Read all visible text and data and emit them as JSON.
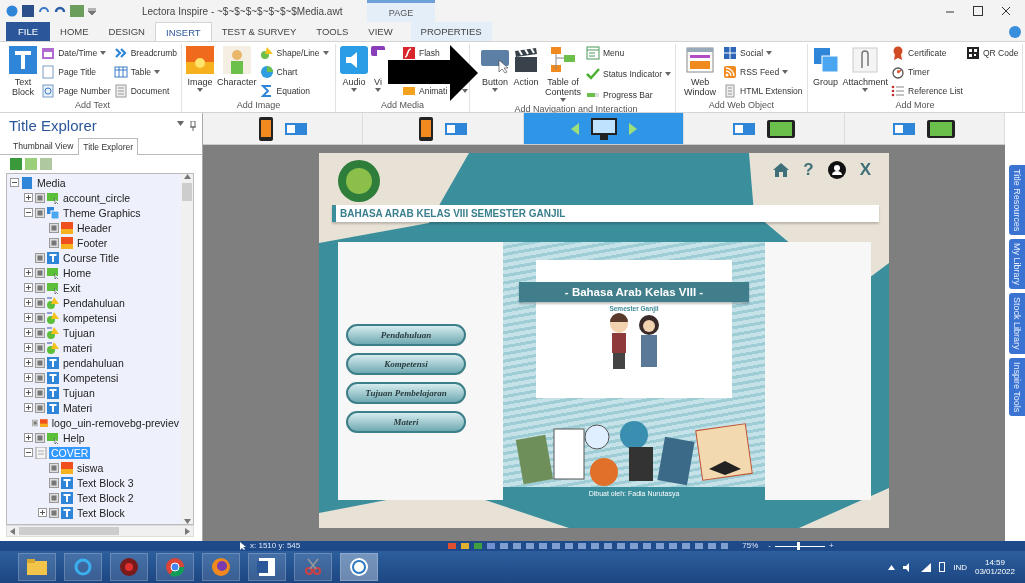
{
  "title_bar": {
    "title": "Lectora Inspire - ~$~$~$~$~$~$~$Media.awt",
    "context_group": "PAGE"
  },
  "ribbon_tabs": [
    {
      "label": "FILE",
      "kind": "file",
      "selected": false
    },
    {
      "label": "HOME",
      "kind": "tab",
      "selected": false
    },
    {
      "label": "DESIGN",
      "kind": "tab",
      "selected": false
    },
    {
      "label": "INSERT",
      "kind": "tab",
      "selected": true
    },
    {
      "label": "TEST & SURVEY",
      "kind": "tab",
      "selected": false
    },
    {
      "label": "TOOLS",
      "kind": "tab",
      "selected": false
    },
    {
      "label": "VIEW",
      "kind": "tab",
      "selected": false
    },
    {
      "label": "PROPERTIES",
      "kind": "context",
      "selected": false
    }
  ],
  "ribbon_groups": [
    {
      "label": "Add Text",
      "large": [
        {
          "label": "Text Block",
          "dropdown": false
        }
      ],
      "columns": [
        [
          {
            "label": "Date/Time",
            "dropdown": true
          },
          {
            "label": "Page Title",
            "dropdown": false
          },
          {
            "label": "Page Number",
            "dropdown": false
          }
        ],
        [
          {
            "label": "Breadcrumb",
            "dropdown": false
          },
          {
            "label": "Table",
            "dropdown": true
          },
          {
            "label": "Document",
            "dropdown": false
          }
        ]
      ]
    },
    {
      "label": "Add Image",
      "large": [
        {
          "label": "Image",
          "dropdown": true
        },
        {
          "label": "Character",
          "dropdown": false
        }
      ],
      "columns": [
        [
          {
            "label": "Shape/Line",
            "dropdown": true
          },
          {
            "label": "Chart",
            "dropdown": false
          },
          {
            "label": "Equation",
            "dropdown": false
          }
        ]
      ]
    },
    {
      "label": "Add Media",
      "large": [
        {
          "label": "Audio",
          "dropdown": true
        },
        {
          "label": "Vi",
          "dropdown": true
        }
      ],
      "columns": [
        [
          {
            "label": "Flash",
            "dropdown": false
          },
          {
            "label": "Animati",
            "dropdown": true
          }
        ]
      ]
    },
    {
      "label": "Add Navigation and Interaction",
      "large": [
        {
          "label": "Button",
          "dropdown": true
        },
        {
          "label": "Action",
          "dropdown": false
        },
        {
          "label": "Table of Contents",
          "dropdown": true
        }
      ],
      "columns": [
        [
          {
            "label": "Menu",
            "dropdown": false
          },
          {
            "label": "Status Indicator",
            "dropdown": true
          },
          {
            "label": "Progress Bar",
            "dropdown": false
          }
        ]
      ]
    },
    {
      "label": "Add Web Object",
      "large": [
        {
          "label": "Web Window",
          "dropdown": false
        }
      ],
      "columns": [
        [
          {
            "label": "Social",
            "dropdown": true
          },
          {
            "label": "RSS Feed",
            "dropdown": true
          },
          {
            "label": "HTML Extension",
            "dropdown": false
          }
        ]
      ]
    },
    {
      "label": "Add More",
      "large": [
        {
          "label": "Group",
          "dropdown": false
        },
        {
          "label": "Attachment",
          "dropdown": true
        }
      ],
      "columns": [
        [
          {
            "label": "Certificate",
            "dropdown": false
          },
          {
            "label": "Timer",
            "dropdown": false
          },
          {
            "label": "Reference List",
            "dropdown": false
          }
        ],
        [
          {
            "label": "QR Code",
            "dropdown": false
          }
        ]
      ]
    }
  ],
  "explorer": {
    "title": "Title Explorer",
    "tabs": [
      {
        "label": "Thumbnail View",
        "selected": false
      },
      {
        "label": "Title Explorer",
        "selected": true
      }
    ],
    "tree": [
      {
        "label": "Media",
        "kind": "book",
        "expanded": true,
        "selected": false,
        "children": [
          {
            "label": "account_circle",
            "kind": "button",
            "expanded": false,
            "selected": false
          },
          {
            "label": "Theme Graphics",
            "kind": "group",
            "expanded": true,
            "selected": false,
            "children": [
              {
                "label": "Header",
                "kind": "image",
                "selected": false
              },
              {
                "label": "Footer",
                "kind": "image",
                "selected": false
              }
            ]
          },
          {
            "label": "Course Title",
            "kind": "text",
            "selected": false
          },
          {
            "label": "Home",
            "kind": "button",
            "expanded": false,
            "selected": false
          },
          {
            "label": "Exit",
            "kind": "button",
            "expanded": false,
            "selected": false
          },
          {
            "label": "Pendahuluan",
            "kind": "shape",
            "expanded": false,
            "selected": false
          },
          {
            "label": "kompetensi",
            "kind": "shape",
            "expanded": false,
            "selected": false
          },
          {
            "label": "Tujuan",
            "kind": "shape",
            "expanded": false,
            "selected": false
          },
          {
            "label": "materi",
            "kind": "shape",
            "expanded": false,
            "selected": false
          },
          {
            "label": "pendahuluan",
            "kind": "text",
            "expanded": false,
            "selected": false
          },
          {
            "label": "Kompetensi",
            "kind": "text",
            "expanded": false,
            "selected": false
          },
          {
            "label": "Tujuan",
            "kind": "text",
            "expanded": false,
            "selected": false
          },
          {
            "label": "Materi",
            "kind": "text",
            "expanded": false,
            "selected": false
          },
          {
            "label": "logo_uin-removebg-previev",
            "kind": "image",
            "selected": false
          },
          {
            "label": "Help",
            "kind": "button",
            "expanded": false,
            "selected": false
          },
          {
            "label": "COVER",
            "kind": "page",
            "expanded": true,
            "selected": true,
            "children": [
              {
                "label": "siswa",
                "kind": "image",
                "selected": false
              },
              {
                "label": "Text Block 3",
                "kind": "text",
                "selected": false
              },
              {
                "label": "Text Block 2",
                "kind": "text",
                "selected": false
              },
              {
                "label": "Text Block",
                "kind": "text",
                "expanded": false,
                "selected": false
              }
            ]
          }
        ]
      }
    ]
  },
  "devices": [
    {
      "kind": "phone",
      "selected": false
    },
    {
      "kind": "phone",
      "selected": false
    },
    {
      "kind": "desktop",
      "selected": true
    },
    {
      "kind": "tablet",
      "selected": false
    },
    {
      "kind": "tablet",
      "selected": false
    }
  ],
  "preview": {
    "help_label": "?",
    "close_label": "X",
    "heading": "BAHASA ARAB KELAS VIII SEMESTER GANJIL",
    "menu": [
      "Pendahuluan",
      "Kompetensi",
      "Tujuan Pembelajaran",
      "Materi"
    ],
    "cover_title": "- Bahasa Arab Kelas VIII -",
    "cover_subtitle": "Semester Ganjil",
    "credit": "Dibuat oleh: Fadia Nurutasya"
  },
  "side_tabs": [
    "Title Resources",
    "My Library",
    "Stock Library",
    "Inspire Tools"
  ],
  "status_bar": {
    "coordinates": "x: 1510 y: 545",
    "zoom": "75%",
    "zoom_out": "-",
    "zoom_in": "+",
    "level": 0.45
  },
  "taskbar": {
    "language": "IND",
    "time": "14:59",
    "date": "03/01/2022"
  }
}
